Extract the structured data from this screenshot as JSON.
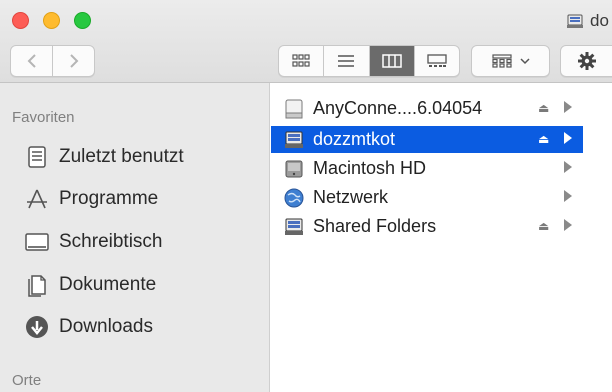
{
  "window": {
    "title": "do"
  },
  "sidebar": {
    "section_favorites": "Favoriten",
    "favorites": [
      {
        "label": "Zuletzt benutzt",
        "icon": "recents-icon"
      },
      {
        "label": "Programme",
        "icon": "applications-icon"
      },
      {
        "label": "Schreibtisch",
        "icon": "desktop-icon"
      },
      {
        "label": "Dokumente",
        "icon": "documents-icon"
      },
      {
        "label": "Downloads",
        "icon": "downloads-icon"
      }
    ],
    "section_locations": "Orte"
  },
  "content": {
    "items": [
      {
        "label": "AnyConne....6.04054",
        "icon": "disk-image-icon",
        "eject": true,
        "selected": false
      },
      {
        "label": "dozzmtkot",
        "icon": "network-server-icon",
        "eject": true,
        "selected": true
      },
      {
        "label": "Macintosh HD",
        "icon": "hard-drive-icon",
        "eject": false,
        "selected": false
      },
      {
        "label": "Netzwerk",
        "icon": "network-globe-icon",
        "eject": false,
        "selected": false
      },
      {
        "label": "Shared Folders",
        "icon": "network-server-icon",
        "eject": true,
        "selected": false
      }
    ]
  },
  "toolbar": {
    "view_modes": [
      "icon",
      "list",
      "column",
      "gallery"
    ],
    "active_view": "column"
  },
  "colors": {
    "selection": "#0b5ce1",
    "sidebar_bg": "#e9e9e9"
  }
}
